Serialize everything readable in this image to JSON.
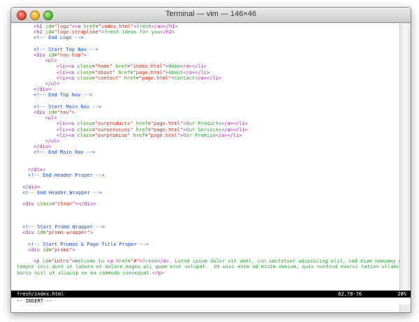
{
  "window": {
    "title": "Terminal — vim — 146×46"
  },
  "lines": [
    "<h1 id=\"logo\"><a href=\"index.html\">fresh</a></h1>",
    "<h2 id=\"logo-strapline\">fresh ideas for you</h2>",
    "<!-- End Logo -->",
    "",
    "<!-- Start Top Nav -->",
    "<div id=\"nav-top\">",
    "  <ul>",
    "    <li><a class=\"home\" href=\"index.html\">Home</a></li>",
    "    <li><a class=\"about\" href=\"page.html\">About</a></li>",
    "    <li><a class=\"contact\" href=\"page.html\">Contact</a></li>",
    "  </ul>",
    "</div>",
    "<!-- End Top Nav -->",
    "",
    "<!-- Start Main Nav -->",
    "<div id=\"nav\">",
    "  <ul>",
    "    <li><a class=\"ourproducts\" href=\"page.html\">Our Products</a></li>",
    "    <li><a class=\"ourservices\" href=\"page.html\">Our Services</a></li>",
    "    <li><a class=\"ourpromise\" href=\"page.html\">Our Promise</a></li>",
    "  </ul>",
    "</div>",
    "<!-- End Main Nav -->",
    "",
    "",
    "</div>",
    "<!-- End Header Proper -->",
    "",
    "</div>",
    "<!-- End Header Wrapper -->",
    "",
    "<div class=\"clear\"></div>",
    "",
    "",
    "",
    "<!-- Start Promo Wrapper -->",
    "<div id=\"promo-wrapper\">",
    "",
    "<!-- Start Promos & Page Title Proper -->",
    "<div id=\"promo\">",
    "",
    "<p id=\"intro\">Welcome to <a href=\"#\">fresh</a>. Lorem ipsum dolor sit amet, con sectetuer adipiscing elit, sed diam nonummy nibh euismod",
    "tempor inci dunt ut labore et dolore magna ali quam erat volupat.  Ut wisi enim ad minim veniam, quis nostrud exerci tation ullamcorper suscipt la",
    "boris nisl ut aliquip ex ea commodo consequat.</p>"
  ],
  "indents": [
    24,
    24,
    24,
    0,
    24,
    24,
    32,
    40,
    40,
    40,
    32,
    24,
    24,
    0,
    24,
    24,
    32,
    40,
    40,
    40,
    32,
    24,
    24,
    0,
    0,
    16,
    16,
    0,
    8,
    8,
    0,
    8,
    0,
    0,
    0,
    8,
    8,
    0,
    16,
    16,
    0,
    24,
    0,
    0
  ],
  "status": {
    "file": "fresh/index.html",
    "position": "62,78-76",
    "percent": "28%"
  },
  "mode": "-- INSERT --"
}
